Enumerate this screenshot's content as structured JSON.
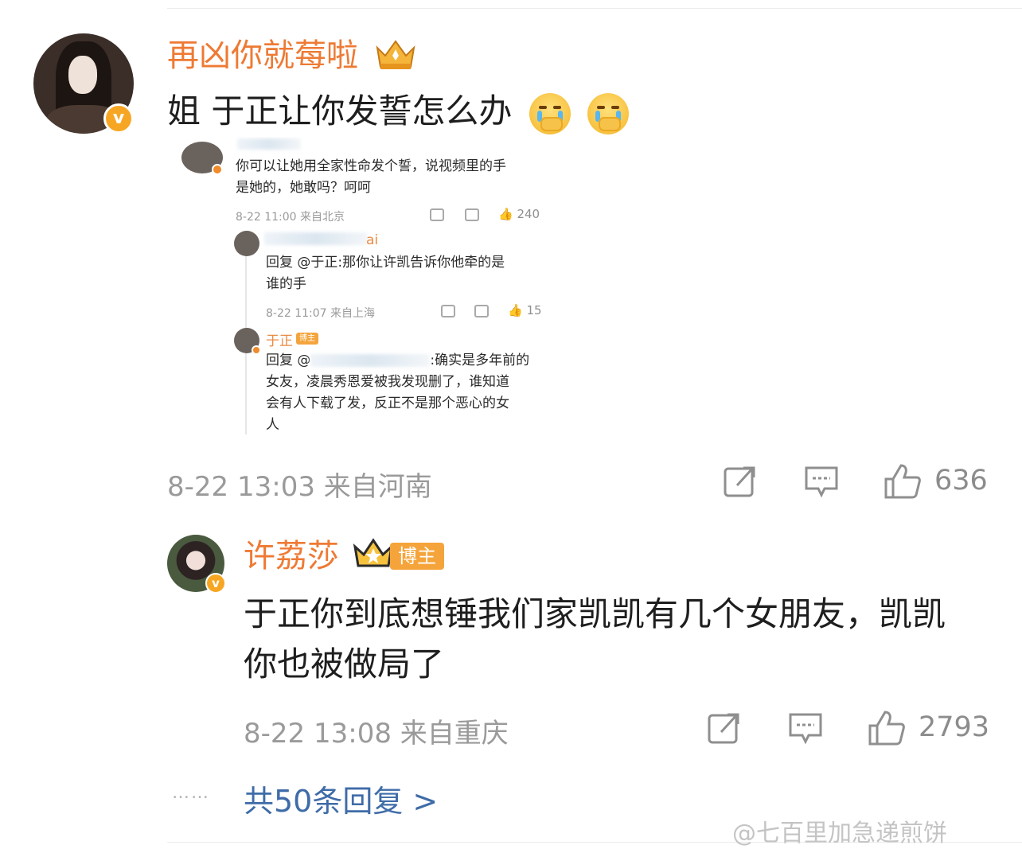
{
  "comment1": {
    "user": "再凶你就莓啦",
    "text": "姐 于正让你发誓怎么办",
    "emojis": [
      "crying-cover-mouth-emoji",
      "crying-cover-mouth-emoji"
    ],
    "time": "8-22 13:03",
    "location": "来自河南",
    "likes": "636"
  },
  "embedded": {
    "post": {
      "text_line1": "你可以让她用全家性命发个誓，说视频里的手",
      "text_line2": "是她的，她敢吗？呵呵",
      "time": "8-22 11:00",
      "location": "来自北京",
      "likes": "240"
    },
    "reply1": {
      "user_suffix": "ai",
      "text_line1": "回复 @于正:那你让许凯告诉你他牵的是",
      "text_line2": "谁的手",
      "time": "8-22 11:07",
      "location": "来自上海",
      "likes": "15"
    },
    "reply2": {
      "user": "于正",
      "tag": "博主",
      "text_prefix": "回复 @",
      "text_line1_tail": ":确实是多年前的",
      "text_line2": "女友，凌晨秀恩爱被我发现删了，谁知道",
      "text_line3": "会有人下载了发，反正不是那个恶心的女",
      "text_line4": "人"
    }
  },
  "comment2": {
    "user": "许荔莎",
    "badge": "博主",
    "text": "于正你到底想锤我们家凯凯有几个女朋友，凯凯你也被做局了",
    "time": "8-22 13:08",
    "location": "来自重庆",
    "likes": "2793"
  },
  "replies_link": "共50条回复 >",
  "dots": "……",
  "watermark": "@七百里加急递煎饼",
  "colors": {
    "name": "#ee7a34",
    "link": "#3f6ca8",
    "meta": "#9a9a9a",
    "badge": "#f5a43b"
  }
}
